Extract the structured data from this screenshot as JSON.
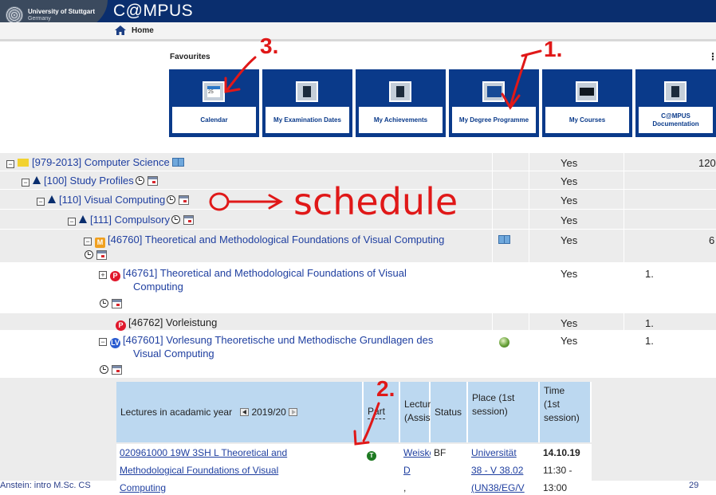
{
  "header": {
    "university_name": "University of Stuttgart",
    "university_country": "Germany",
    "app_title": "C@MPUS"
  },
  "nav": {
    "home_label": "Home"
  },
  "favourites": {
    "title": "Favourites",
    "menu_glyph": "⋮",
    "tiles": [
      {
        "label": "Calendar",
        "icon": "calendar-icon",
        "day": "25"
      },
      {
        "label": "My Examination Dates",
        "icon": "document-icon"
      },
      {
        "label": "My Achievements",
        "icon": "document-icon"
      },
      {
        "label": "My Degree Programme",
        "icon": "graduation-cap-icon"
      },
      {
        "label": "My Courses",
        "icon": "screen-icon"
      },
      {
        "label": "C@MPUS Documentation",
        "icon": "document-icon"
      }
    ]
  },
  "tree": {
    "rows": [
      {
        "id": "[979-2013]",
        "title": "Computer Science",
        "yes": "Yes",
        "extra": "120"
      },
      {
        "id": "[100]",
        "title": "Study Profiles",
        "yes": "Yes"
      },
      {
        "id": "[110]",
        "title": "Visual Computing",
        "yes": "Yes"
      },
      {
        "id": "[111]",
        "title": "Compulsory",
        "yes": "Yes"
      },
      {
        "id": "[46760]",
        "title": "Theoretical and Methodological Foundations of Visual Computing",
        "yes": "Yes",
        "extra": "6"
      },
      {
        "id": "[46761]",
        "title_line1": "Theoretical and Methodological Foundations of Visual",
        "title_line2": "Computing",
        "yes": "Yes",
        "num": "1."
      },
      {
        "id": "[46762]",
        "title": "Vorleistung",
        "yes": "Yes",
        "num": "1."
      },
      {
        "id": "[467601]",
        "title_line1": "Vorlesung Theoretische und Methodische Grundlagen des",
        "title_line2": "Visual Computing",
        "yes": "Yes",
        "num": "1."
      }
    ],
    "badges": {
      "module": "M",
      "exam": "P",
      "lecture": "LV",
      "part": "T"
    }
  },
  "lectures": {
    "headers": {
      "year_label": "Lectures in acadamic year",
      "year_value": "2019/20",
      "part": "Part",
      "lecturer_1": "Lecturer",
      "lecturer_2": "(Assistant)",
      "status": "Status",
      "place_1": "Place (1st",
      "place_2": "session)",
      "time_1": "Time",
      "time_2": "(1st",
      "time_3": "session)"
    },
    "row": {
      "course_1": "020961000 19W 3SH L Theoretical and",
      "course_2": "Methodological Foundations of Visual",
      "course_3": "Computing",
      "lecturer_1": "Weiskopf",
      "lecturer_2": "D",
      "lecturer_3": ",",
      "status": "BF",
      "place_1": "Universität",
      "place_2": "38 - V 38.02",
      "place_3": "(UN38/EG/V",
      "date": "14.10.19",
      "time_1": "11:30 -",
      "time_2": "13:00"
    }
  },
  "annotations": {
    "one": "1.",
    "two": "2.",
    "three": "3.",
    "schedule": "schedule"
  },
  "footer": {
    "left": "Anstein: intro M.Sc. CS",
    "page": "29"
  },
  "colors": {
    "header_blue": "#0a2e6e",
    "tile_blue": "#0a3a8a",
    "table_header": "#bcd8f0",
    "annotation_red": "#e01818"
  }
}
